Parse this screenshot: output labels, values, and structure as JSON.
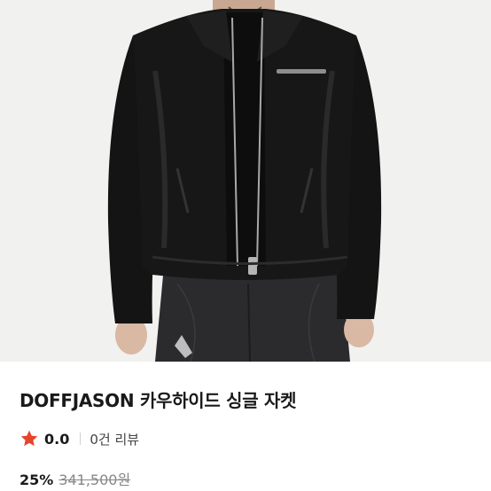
{
  "product": {
    "title": "DOFFJASON 카우하이드 싱글 자켓",
    "rating": "0.0",
    "review_count": "0건 리뷰",
    "discount": "25%",
    "original_price": "341,500원",
    "star_color": "#e8432b"
  }
}
